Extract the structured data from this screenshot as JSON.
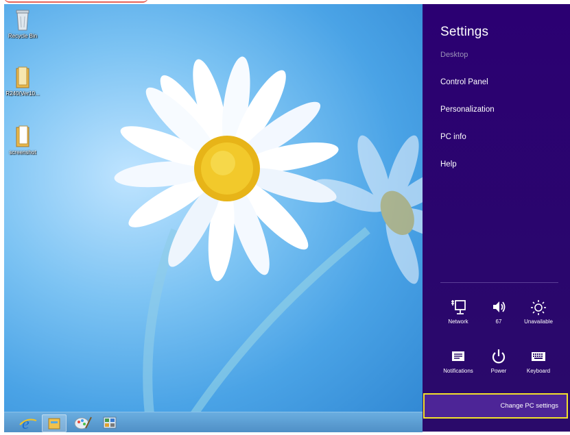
{
  "desktop": {
    "icons": [
      {
        "label": "Recycle Bin",
        "icon": "recycle-bin-icon"
      },
      {
        "label": "R240(Ver10...",
        "icon": "folder-icon"
      },
      {
        "label": "screenshot",
        "icon": "folder-icon"
      }
    ]
  },
  "taskbar": {
    "items": [
      {
        "name": "internet-explorer",
        "icon": "internet-explorer-icon"
      },
      {
        "name": "file-explorer",
        "icon": "file-explorer-icon"
      },
      {
        "name": "paint",
        "icon": "paint-icon"
      },
      {
        "name": "control-panel",
        "icon": "control-panel-icon"
      }
    ]
  },
  "settings": {
    "title": "Settings",
    "subtitle": "Desktop",
    "menu": [
      {
        "label": "Control Panel"
      },
      {
        "label": "Personalization"
      },
      {
        "label": "PC info"
      },
      {
        "label": "Help"
      }
    ],
    "quick": [
      {
        "label": "Network",
        "icon": "network-icon"
      },
      {
        "label": "67",
        "icon": "volume-icon"
      },
      {
        "label": "Unavailable",
        "icon": "brightness-icon"
      },
      {
        "label": "Notifications",
        "icon": "notifications-icon"
      },
      {
        "label": "Power",
        "icon": "power-icon"
      },
      {
        "label": "Keyboard",
        "icon": "keyboard-icon"
      }
    ],
    "change_pc_settings": "Change PC settings"
  },
  "colors": {
    "charm_bg": "#2a0070",
    "highlight_border": "#f3e22b",
    "desktop_sky": "#4aa3e6"
  }
}
